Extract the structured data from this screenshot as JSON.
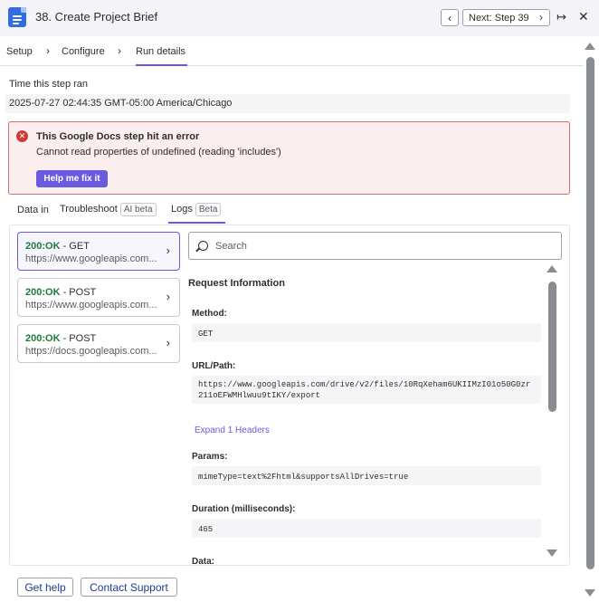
{
  "header": {
    "title": "38. Create Project Brief",
    "prev_label": "‹",
    "next_label": "Next: Step 39",
    "next_chev": "›",
    "expand_glyph": "↦",
    "close_glyph": "✕",
    "app_icon": "google-docs-icon"
  },
  "steps": {
    "items": [
      {
        "label": "Setup"
      },
      {
        "label": "Configure"
      },
      {
        "label": "Run details"
      }
    ],
    "separator": "›",
    "active": "Run details"
  },
  "run": {
    "time_label": "Time this step ran",
    "timestamp": "2025-07-27 02:44:35 GMT-05:00 America/Chicago"
  },
  "error": {
    "icon_glyph": "✕",
    "title": "This Google Docs step hit an error",
    "message": "Cannot read properties of undefined (reading 'includes')",
    "fix_button": "Help me fix it",
    "colors": {
      "border": "#d96b6b",
      "background": "#fbeeee",
      "icon": "#cf3a3a"
    }
  },
  "subtabs": {
    "data_in": "Data in",
    "troubleshoot": "Troubleshoot",
    "troubleshoot_badge": "AI beta",
    "logs": "Logs",
    "logs_badge": "Beta",
    "active": "Logs"
  },
  "requests": [
    {
      "status": "200:OK",
      "method": " - GET",
      "url": "https://www.googleapis.com...",
      "selected": true
    },
    {
      "status": "200:OK",
      "method": " - POST",
      "url": "https://www.googleapis.com...",
      "selected": false
    },
    {
      "status": "200:OK",
      "method": " - POST",
      "url": "https://docs.googleapis.com...",
      "selected": false
    }
  ],
  "request_chev": "›",
  "search": {
    "placeholder": "Search",
    "value": ""
  },
  "detail": {
    "title": "Request Information",
    "method_label": "Method:",
    "method_value": "GET",
    "url_label": "URL/Path:",
    "url_value": "https://www.googleapis.com/drive/v2/files/10RqXeham6UKIIMzI01o50G0zr211oEFWMHlwuu9tIKY/export",
    "expand_headers": "Expand 1 Headers",
    "params_label": "Params:",
    "params_value": "mimeType=text%2Fhtml&supportsAllDrives=true",
    "duration_label": "Duration (milliseconds):",
    "duration_value": "465",
    "data_label": "Data:"
  },
  "footer": {
    "get_help": "Get help",
    "contact_support": "Contact Support"
  },
  "colors": {
    "accent": "#6a5ae0",
    "ok_green": "#1c7a3c",
    "link_blue": "#1f3c8f",
    "docs_blue": "#2f6de1"
  }
}
